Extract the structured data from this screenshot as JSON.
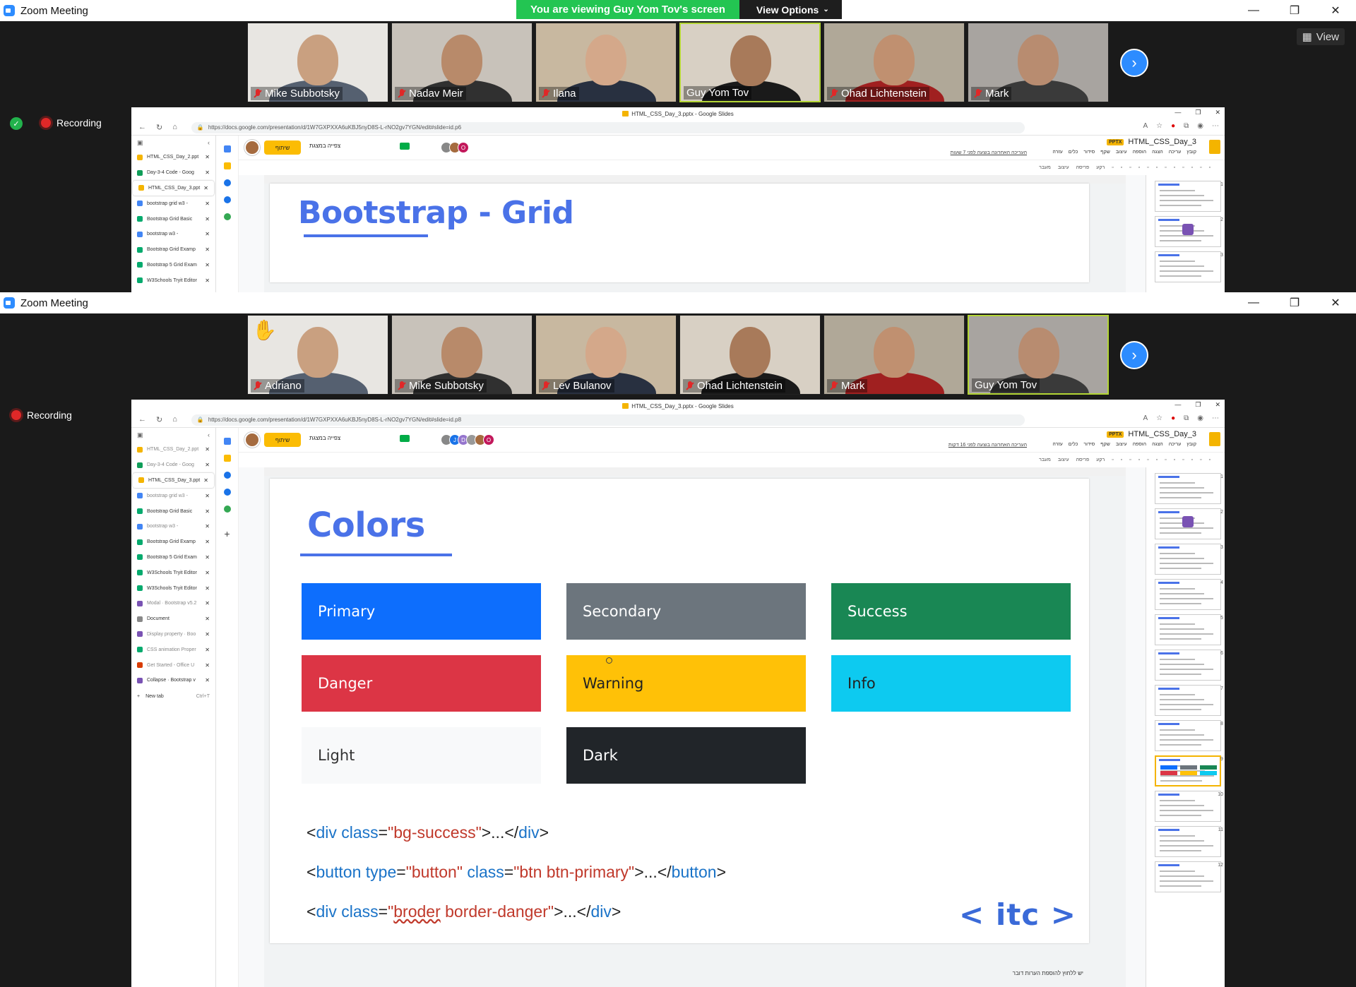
{
  "zoom1": {
    "window_title": "Zoom Meeting",
    "share_message": "You are viewing Guy Yom Tov's screen",
    "view_options": "View Options",
    "view_button": "View",
    "recording": "Recording",
    "participants": [
      {
        "name": "Mike Subbotsky",
        "muted": true
      },
      {
        "name": "Nadav Meir",
        "muted": true
      },
      {
        "name": "Ilana",
        "muted": true
      },
      {
        "name": "Guy Yom Tov",
        "muted": false,
        "active": true
      },
      {
        "name": "Ohad Lichtenstein",
        "muted": true
      },
      {
        "name": "Mark",
        "muted": true
      }
    ]
  },
  "zoom2": {
    "window_title": "Zoom Meeting",
    "recording": "Recording",
    "participants": [
      {
        "name": "Adriano",
        "muted": true,
        "hand": true
      },
      {
        "name": "Mike Subbotsky",
        "muted": true
      },
      {
        "name": "Lev Bulanov",
        "muted": true
      },
      {
        "name": "Ohad Lichtenstein",
        "muted": true
      },
      {
        "name": "Mark",
        "muted": true
      },
      {
        "name": "Guy Yom Tov",
        "muted": false,
        "active": true
      }
    ]
  },
  "browser1": {
    "tab_title": "HTML_CSS_Day_3.pptx - Google Slides",
    "url": "https://docs.google.com/presentation/d/1W7GXPXXA6uKBJ5nyD8S-L-rNO2gv7YGN/edit#slide=id.p6",
    "tabs": [
      {
        "label": "HTML_CSS_Day_2.ppt",
        "color": "#f4b400"
      },
      {
        "label": "Day-3-4 Code - Goog",
        "color": "#0f9d58"
      },
      {
        "label": "HTML_CSS_Day_3.ppt",
        "color": "#f4b400",
        "selected": true
      },
      {
        "label": "bootstrap grid w3 - ",
        "color": "#4285f4"
      },
      {
        "label": "Bootstrap Grid Basic",
        "color": "#04aa6d"
      },
      {
        "label": "bootstrap w3 - ",
        "color": "#4285f4"
      },
      {
        "label": "Bootstrap Grid Examp",
        "color": "#04aa6d"
      },
      {
        "label": "Bootstrap 5 Grid Exam",
        "color": "#04aa6d"
      },
      {
        "label": "W3Schools Tryit Editor",
        "color": "#04aa6d"
      }
    ]
  },
  "browser2": {
    "tab_title": "HTML_CSS_Day_3.pptx - Google Slides",
    "url": "https://docs.google.com/presentation/d/1W7GXPXXA6uKBJ5nyD8S-L-rNO2gv7YGN/edit#slide=id.p8",
    "tabs": [
      {
        "label": "HTML_CSS_Day_2.ppt",
        "color": "#f4b400",
        "dim": true
      },
      {
        "label": "Day-3-4 Code - Goog",
        "color": "#0f9d58",
        "dim": true
      },
      {
        "label": "HTML_CSS_Day_3.ppt",
        "color": "#f4b400",
        "selected": true
      },
      {
        "label": "bootstrap grid w3 - ",
        "color": "#4285f4",
        "dim": true
      },
      {
        "label": "Bootstrap Grid Basic",
        "color": "#04aa6d"
      },
      {
        "label": "bootstrap w3 - ",
        "color": "#4285f4",
        "dim": true
      },
      {
        "label": "Bootstrap Grid Examp",
        "color": "#04aa6d"
      },
      {
        "label": "Bootstrap 5 Grid Exam",
        "color": "#04aa6d"
      },
      {
        "label": "W3Schools Tryit Editor",
        "color": "#04aa6d"
      },
      {
        "label": "W3Schools Tryit Editor",
        "color": "#04aa6d"
      },
      {
        "label": "Modal · Bootstrap v5.2",
        "color": "#7952b3",
        "dim": true
      },
      {
        "label": "Document",
        "color": "#888888"
      },
      {
        "label": "Display property · Boo",
        "color": "#7952b3",
        "dim": true
      },
      {
        "label": "CSS animation Proper",
        "color": "#04aa6d",
        "dim": true
      },
      {
        "label": "Get Started - Office U",
        "color": "#d83b01",
        "dim": true
      },
      {
        "label": "Collapse · Bootstrap v",
        "color": "#7952b3"
      }
    ],
    "new_tab": "New tab",
    "new_tab_kbd": "Ctrl+T"
  },
  "slides_app": {
    "doc_title": "HTML_CSS_Day_3",
    "badge": "PPTX",
    "share_label": "שיתוף",
    "present_label": "צפייה במצגת",
    "menu": [
      "קובץ",
      "עריכה",
      "הצגה",
      "הוספה",
      "עיצוב",
      "שקף",
      "סידור",
      "כלים",
      "עזרה"
    ],
    "last_edit_1": "העריכה האחרונה בוצעה לפני 7 שעות",
    "last_edit_2": "העריכה האחרונה בוצעה לפני 16 דקות",
    "toolbar": [
      "מעבר",
      "עיצוב",
      "פריסה",
      "רקע"
    ],
    "speaker_notes": "יש ללחוץ להוספת הערות דובר"
  },
  "slide1": {
    "title": "Bootstrap - Grid"
  },
  "slide2": {
    "title": "Colors",
    "boxes": [
      {
        "label": "Primary",
        "bg": "#0d6efd",
        "fg": "#ffffff"
      },
      {
        "label": "Secondary",
        "bg": "#6c757d",
        "fg": "#ffffff"
      },
      {
        "label": "Success",
        "bg": "#198754",
        "fg": "#ffffff"
      },
      {
        "label": "Danger",
        "bg": "#dc3545",
        "fg": "#ffffff"
      },
      {
        "label": "Warning",
        "bg": "#ffc107",
        "fg": "#222222"
      },
      {
        "label": "Info",
        "bg": "#0dcaf0",
        "fg": "#222222"
      },
      {
        "label": "Light",
        "bg": "#f8f9fa",
        "fg": "#333333"
      },
      {
        "label": "Dark",
        "bg": "#212529",
        "fg": "#ffffff"
      }
    ],
    "code_lines": [
      [
        {
          "t": "<"
        },
        {
          "t": "div",
          "c": "tg"
        },
        {
          "t": " "
        },
        {
          "t": "class",
          "c": "tg"
        },
        {
          "t": "="
        },
        {
          "t": "\"bg-success\"",
          "c": "st"
        },
        {
          "t": ">...</"
        },
        {
          "t": "div",
          "c": "tg"
        },
        {
          "t": ">"
        }
      ],
      [
        {
          "t": "<"
        },
        {
          "t": "button",
          "c": "tg"
        },
        {
          "t": " "
        },
        {
          "t": "type",
          "c": "tg"
        },
        {
          "t": "="
        },
        {
          "t": "\"button\"",
          "c": "st"
        },
        {
          "t": " "
        },
        {
          "t": "class",
          "c": "tg"
        },
        {
          "t": "="
        },
        {
          "t": "\"btn btn-primary\"",
          "c": "st"
        },
        {
          "t": ">...</"
        },
        {
          "t": "button",
          "c": "tg"
        },
        {
          "t": ">"
        }
      ],
      [
        {
          "t": "<"
        },
        {
          "t": "div",
          "c": "tg"
        },
        {
          "t": " "
        },
        {
          "t": "class",
          "c": "tg"
        },
        {
          "t": "="
        },
        {
          "t": "\"",
          "c": "st"
        },
        {
          "t": "broder",
          "c": "st sq"
        },
        {
          "t": " border-danger\"",
          "c": "st"
        },
        {
          "t": ">...</"
        },
        {
          "t": "div",
          "c": "tg"
        },
        {
          "t": ">"
        }
      ]
    ],
    "logo": "< itc >"
  },
  "filmstrip_numbers": [
    "1",
    "2",
    "3",
    "4",
    "5",
    "6",
    "7",
    "8",
    "9",
    "10",
    "11",
    "12"
  ],
  "colors": {
    "zoom_blue": "#2d8cff",
    "share_green": "#23c552",
    "slide_blue": "#4a72e8",
    "active_border": "#b3d534"
  }
}
